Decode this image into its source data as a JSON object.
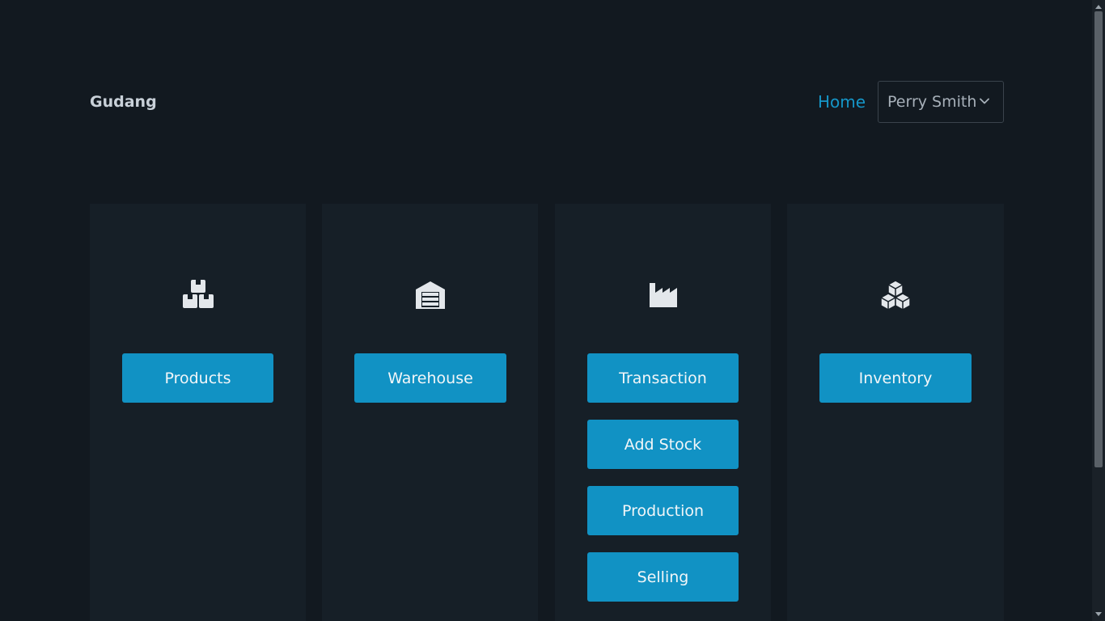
{
  "header": {
    "brand": "Gudang",
    "nav_home": "Home",
    "user_select": {
      "selected": "Perry Smith",
      "icon": "chevron-down-icon"
    }
  },
  "cards": [
    {
      "icon": "boxes-icon",
      "buttons": [
        "Products"
      ]
    },
    {
      "icon": "warehouse-icon",
      "buttons": [
        "Warehouse"
      ]
    },
    {
      "icon": "industry-icon",
      "buttons": [
        "Transaction",
        "Add Stock",
        "Production",
        "Selling"
      ]
    },
    {
      "icon": "cubes-icon",
      "buttons": [
        "Inventory"
      ]
    }
  ],
  "colors": {
    "background": "#121920",
    "card": "#161f27",
    "accent": "#1192c4",
    "link": "#1596c8"
  }
}
